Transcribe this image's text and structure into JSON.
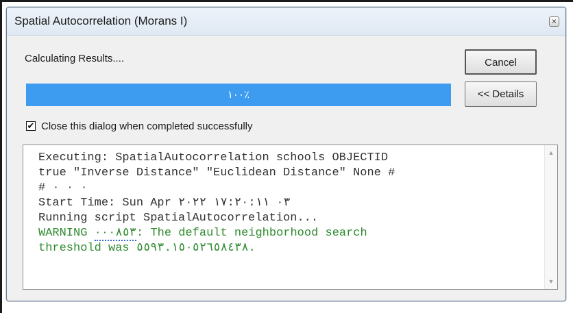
{
  "window": {
    "title": "Spatial Autocorrelation (Morans I)",
    "close_glyph": "×"
  },
  "status": {
    "text": "Calculating Results...."
  },
  "buttons": {
    "cancel_label": "Cancel",
    "details_label": "<< Details"
  },
  "progress": {
    "text": "١٠٠٪",
    "value_percent": 100,
    "color": "#3d9bf0"
  },
  "checkbox": {
    "checked": true,
    "glyph": "✔",
    "label": "Close this dialog when completed successfully"
  },
  "log": {
    "line1": "Executing: SpatialAutocorrelation schools OBJECTID",
    "line2": "true \"Inverse Distance\" \"Euclidean Distance\" None #",
    "line3": "# ٠ ٠ ٠",
    "line4": "Start Time: Sun Apr ٠٣ ١٧:٢٠:١١ ٢٠٢٢",
    "line5": "Running script SpatialAutocorrelation...",
    "warning_prefix": "WARNING ",
    "warning_code": "٠٠٠٨٥٣",
    "warning_rest": ": The default neighborhood search",
    "line7": "threshold was ٥٥٩٣.١٥٠٥٢٦٥٨٤٣٨.",
    "warning_color": "#2e8b2e"
  },
  "scrollbar": {
    "up_glyph": "▲",
    "down_glyph": "▼"
  }
}
